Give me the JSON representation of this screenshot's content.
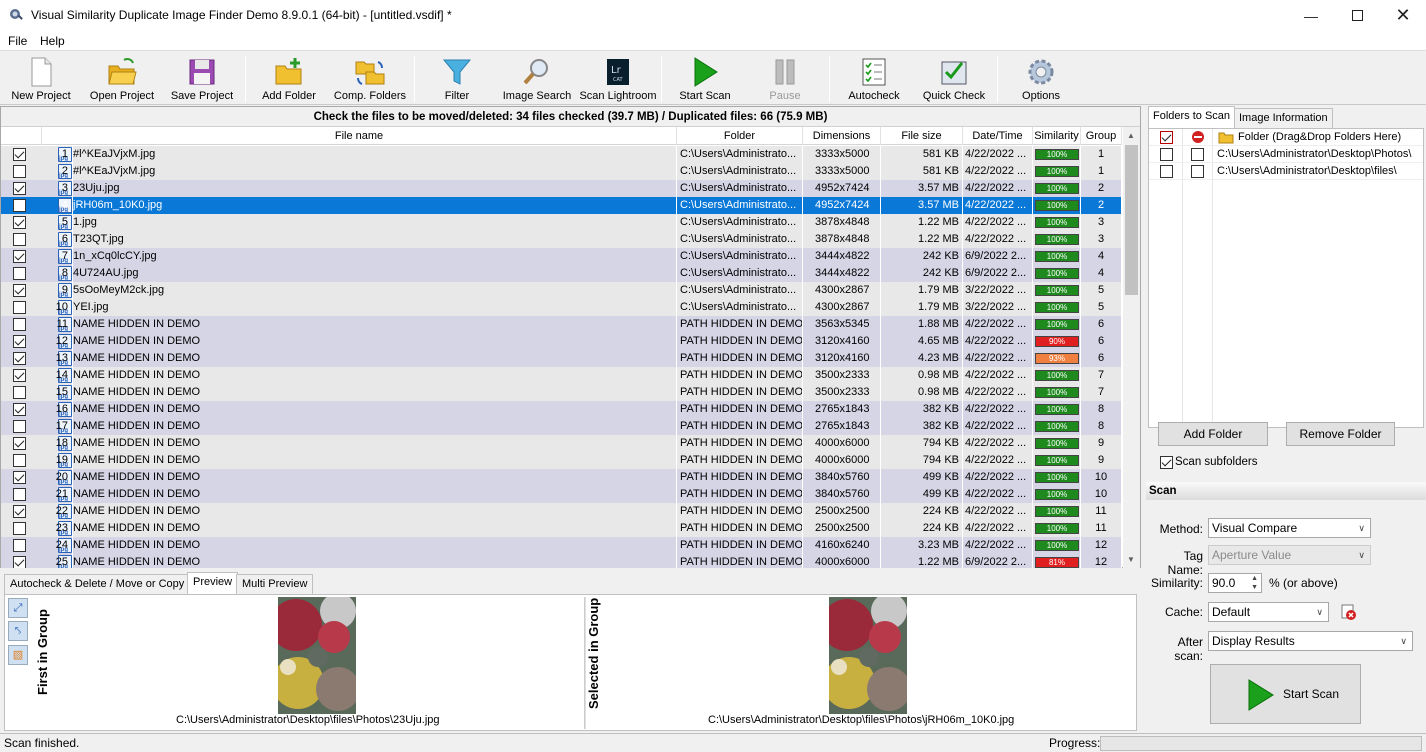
{
  "window": {
    "title": "Visual Similarity Duplicate Image Finder Demo 8.9.0.1 (64-bit) - [untitled.vsdif] *"
  },
  "menu": [
    "File",
    "Help"
  ],
  "toolbar": {
    "new_project": "New Project",
    "open_project": "Open Project",
    "save_project": "Save Project",
    "add_folder": "Add Folder",
    "comp_folders": "Comp. Folders",
    "filter": "Filter",
    "image_search": "Image Search",
    "scan_lightroom": "Scan Lightroom",
    "start_scan": "Start Scan",
    "pause": "Pause",
    "autocheck": "Autocheck",
    "quick_check": "Quick Check",
    "options": "Options"
  },
  "summary": "Check the files to be moved/deleted: 34 files checked (39.7 MB) / Duplicated files: 66 (75.9 MB)",
  "columns": {
    "file_name": "File name",
    "folder": "Folder",
    "dimensions": "Dimensions",
    "file_size": "File size",
    "date_time": "Date/Time",
    "similarity": "Similarity",
    "group": "Group"
  },
  "rows": [
    {
      "n": "1",
      "checked": true,
      "name": "#l^KEaJVjxM.jpg",
      "folder": "C:\\Users\\Administrato...",
      "dim": "3333x5000",
      "size": "581 KB",
      "date": "4/22/2022 ...",
      "sim": "100%",
      "group": "1"
    },
    {
      "n": "2",
      "checked": false,
      "name": "#l^KEaJVjxM.jpg",
      "folder": "C:\\Users\\Administrato...",
      "dim": "3333x5000",
      "size": "581 KB",
      "date": "4/22/2022 ...",
      "sim": "100%",
      "group": "1"
    },
    {
      "n": "3",
      "checked": true,
      "name": "23Uju.jpg",
      "folder": "C:\\Users\\Administrato...",
      "dim": "4952x7424",
      "size": "3.57 MB",
      "date": "4/22/2022 ...",
      "sim": "100%",
      "group": "2"
    },
    {
      "n": "4",
      "checked": false,
      "name": "jRH06m_10K0.jpg",
      "folder": "C:\\Users\\Administrato...",
      "dim": "4952x7424",
      "size": "3.57 MB",
      "date": "4/22/2022 ...",
      "sim": "100%",
      "group": "2",
      "selected": true
    },
    {
      "n": "5",
      "checked": true,
      "name": "1.jpg",
      "folder": "C:\\Users\\Administrato...",
      "dim": "3878x4848",
      "size": "1.22 MB",
      "date": "4/22/2022 ...",
      "sim": "100%",
      "group": "3"
    },
    {
      "n": "6",
      "checked": false,
      "name": "T23QT.jpg",
      "folder": "C:\\Users\\Administrato...",
      "dim": "3878x4848",
      "size": "1.22 MB",
      "date": "4/22/2022 ...",
      "sim": "100%",
      "group": "3"
    },
    {
      "n": "7",
      "checked": true,
      "name": "1n_xCq0lcCY.jpg",
      "folder": "C:\\Users\\Administrato...",
      "dim": "3444x4822",
      "size": "242 KB",
      "date": "6/9/2022 2...",
      "sim": "100%",
      "group": "4"
    },
    {
      "n": "8",
      "checked": false,
      "name": "4U724AU.jpg",
      "folder": "C:\\Users\\Administrato...",
      "dim": "3444x4822",
      "size": "242 KB",
      "date": "6/9/2022 2...",
      "sim": "100%",
      "group": "4"
    },
    {
      "n": "9",
      "checked": true,
      "name": "5sOoMeyM2ck.jpg",
      "folder": "C:\\Users\\Administrato...",
      "dim": "4300x2867",
      "size": "1.79 MB",
      "date": "3/22/2022 ...",
      "sim": "100%",
      "group": "5"
    },
    {
      "n": "10",
      "checked": false,
      "name": "YEI.jpg",
      "folder": "C:\\Users\\Administrato...",
      "dim": "4300x2867",
      "size": "1.79 MB",
      "date": "3/22/2022 ...",
      "sim": "100%",
      "group": "5"
    },
    {
      "n": "11",
      "checked": false,
      "name": "NAME HIDDEN IN DEMO",
      "folder": "PATH HIDDEN IN DEMO",
      "dim": "3563x5345",
      "size": "1.88 MB",
      "date": "4/22/2022 ...",
      "sim": "100%",
      "group": "6"
    },
    {
      "n": "12",
      "checked": true,
      "name": "NAME HIDDEN IN DEMO",
      "folder": "PATH HIDDEN IN DEMO",
      "dim": "3120x4160",
      "size": "4.65 MB",
      "date": "4/22/2022 ...",
      "sim": "90%",
      "group": "6"
    },
    {
      "n": "13",
      "checked": true,
      "name": "NAME HIDDEN IN DEMO",
      "folder": "PATH HIDDEN IN DEMO",
      "dim": "3120x4160",
      "size": "4.23 MB",
      "date": "4/22/2022 ...",
      "sim": "93%",
      "group": "6"
    },
    {
      "n": "14",
      "checked": true,
      "name": "NAME HIDDEN IN DEMO",
      "folder": "PATH HIDDEN IN DEMO",
      "dim": "3500x2333",
      "size": "0.98 MB",
      "date": "4/22/2022 ...",
      "sim": "100%",
      "group": "7"
    },
    {
      "n": "15",
      "checked": false,
      "name": "NAME HIDDEN IN DEMO",
      "folder": "PATH HIDDEN IN DEMO",
      "dim": "3500x2333",
      "size": "0.98 MB",
      "date": "4/22/2022 ...",
      "sim": "100%",
      "group": "7"
    },
    {
      "n": "16",
      "checked": true,
      "name": "NAME HIDDEN IN DEMO",
      "folder": "PATH HIDDEN IN DEMO",
      "dim": "2765x1843",
      "size": "382 KB",
      "date": "4/22/2022 ...",
      "sim": "100%",
      "group": "8"
    },
    {
      "n": "17",
      "checked": false,
      "name": "NAME HIDDEN IN DEMO",
      "folder": "PATH HIDDEN IN DEMO",
      "dim": "2765x1843",
      "size": "382 KB",
      "date": "4/22/2022 ...",
      "sim": "100%",
      "group": "8"
    },
    {
      "n": "18",
      "checked": true,
      "name": "NAME HIDDEN IN DEMO",
      "folder": "PATH HIDDEN IN DEMO",
      "dim": "4000x6000",
      "size": "794 KB",
      "date": "4/22/2022 ...",
      "sim": "100%",
      "group": "9"
    },
    {
      "n": "19",
      "checked": false,
      "name": "NAME HIDDEN IN DEMO",
      "folder": "PATH HIDDEN IN DEMO",
      "dim": "4000x6000",
      "size": "794 KB",
      "date": "4/22/2022 ...",
      "sim": "100%",
      "group": "9"
    },
    {
      "n": "20",
      "checked": true,
      "name": "NAME HIDDEN IN DEMO",
      "folder": "PATH HIDDEN IN DEMO",
      "dim": "3840x5760",
      "size": "499 KB",
      "date": "4/22/2022 ...",
      "sim": "100%",
      "group": "10"
    },
    {
      "n": "21",
      "checked": false,
      "name": "NAME HIDDEN IN DEMO",
      "folder": "PATH HIDDEN IN DEMO",
      "dim": "3840x5760",
      "size": "499 KB",
      "date": "4/22/2022 ...",
      "sim": "100%",
      "group": "10"
    },
    {
      "n": "22",
      "checked": true,
      "name": "NAME HIDDEN IN DEMO",
      "folder": "PATH HIDDEN IN DEMO",
      "dim": "2500x2500",
      "size": "224 KB",
      "date": "4/22/2022 ...",
      "sim": "100%",
      "group": "11"
    },
    {
      "n": "23",
      "checked": false,
      "name": "NAME HIDDEN IN DEMO",
      "folder": "PATH HIDDEN IN DEMO",
      "dim": "2500x2500",
      "size": "224 KB",
      "date": "4/22/2022 ...",
      "sim": "100%",
      "group": "11"
    },
    {
      "n": "24",
      "checked": false,
      "name": "NAME HIDDEN IN DEMO",
      "folder": "PATH HIDDEN IN DEMO",
      "dim": "4160x6240",
      "size": "3.23 MB",
      "date": "4/22/2022 ...",
      "sim": "100%",
      "group": "12"
    },
    {
      "n": "25",
      "checked": true,
      "name": "NAME HIDDEN IN DEMO",
      "folder": "PATH HIDDEN IN DEMO",
      "dim": "4000x6000",
      "size": "1.22 MB",
      "date": "6/9/2022 2...",
      "sim": "81%",
      "group": "12"
    }
  ],
  "bottom_tabs": [
    "Autocheck & Delete / Move or Copy",
    "Preview",
    "Multi Preview"
  ],
  "preview": {
    "first_label": "First in Group",
    "selected_label": "Selected in Group",
    "first_path": "C:\\Users\\Administrator\\Desktop\\files\\Photos\\23Uju.jpg",
    "selected_path": "C:\\Users\\Administrator\\Desktop\\files\\Photos\\jRH06m_10K0.jpg"
  },
  "right_tabs": [
    "Folders to Scan",
    "Image Information"
  ],
  "folders": [
    {
      "checked": true,
      "excluded": true,
      "path": "Folder (Drag&Drop Folders Here)"
    },
    {
      "checked": false,
      "excluded": false,
      "path": "C:\\Users\\Administrator\\Desktop\\Photos\\"
    },
    {
      "checked": false,
      "excluded": false,
      "path": "C:\\Users\\Administrator\\Desktop\\files\\"
    }
  ],
  "folder_buttons": {
    "add": "Add Folder",
    "remove": "Remove Folder"
  },
  "scan_subfolders": "Scan subfolders",
  "scan": {
    "header": "Scan",
    "method_label": "Method:",
    "method_value": "Visual Compare",
    "tag_label": "Tag Name:",
    "tag_value": "Aperture Value",
    "similarity_label": "Similarity:",
    "similarity_value": "90.0",
    "similarity_suffix": "% (or above)",
    "cache_label": "Cache:",
    "cache_value": "Default",
    "after_label": "After scan:",
    "after_value": "Display Results",
    "start_button": "Start Scan"
  },
  "status": {
    "text": "Scan finished.",
    "progress_label": "Progress:"
  },
  "colors": {
    "selection": "#0a78d7",
    "sim_ok": "#1e8a1e",
    "sim_warn_90": "#e02020",
    "sim_warn_93": "#f08040",
    "row_group_a": "#e8e8e8",
    "row_group_b": "#d5d5e6"
  }
}
